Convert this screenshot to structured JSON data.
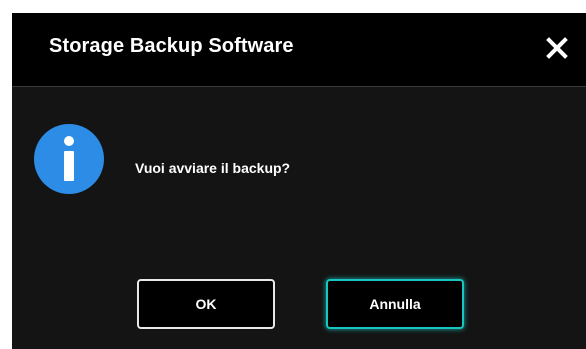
{
  "dialog": {
    "title": "Storage Backup Software",
    "message": "Vuoi avviare il backup?",
    "icon": "info-icon",
    "close_icon": "close-icon"
  },
  "buttons": {
    "ok_label": "OK",
    "cancel_label": "Annulla"
  },
  "colors": {
    "titlebar_bg": "#000000",
    "body_bg": "#141414",
    "info_blue": "#2c8ce6",
    "focus_accent": "#19c5c0",
    "text": "#ffffff"
  }
}
